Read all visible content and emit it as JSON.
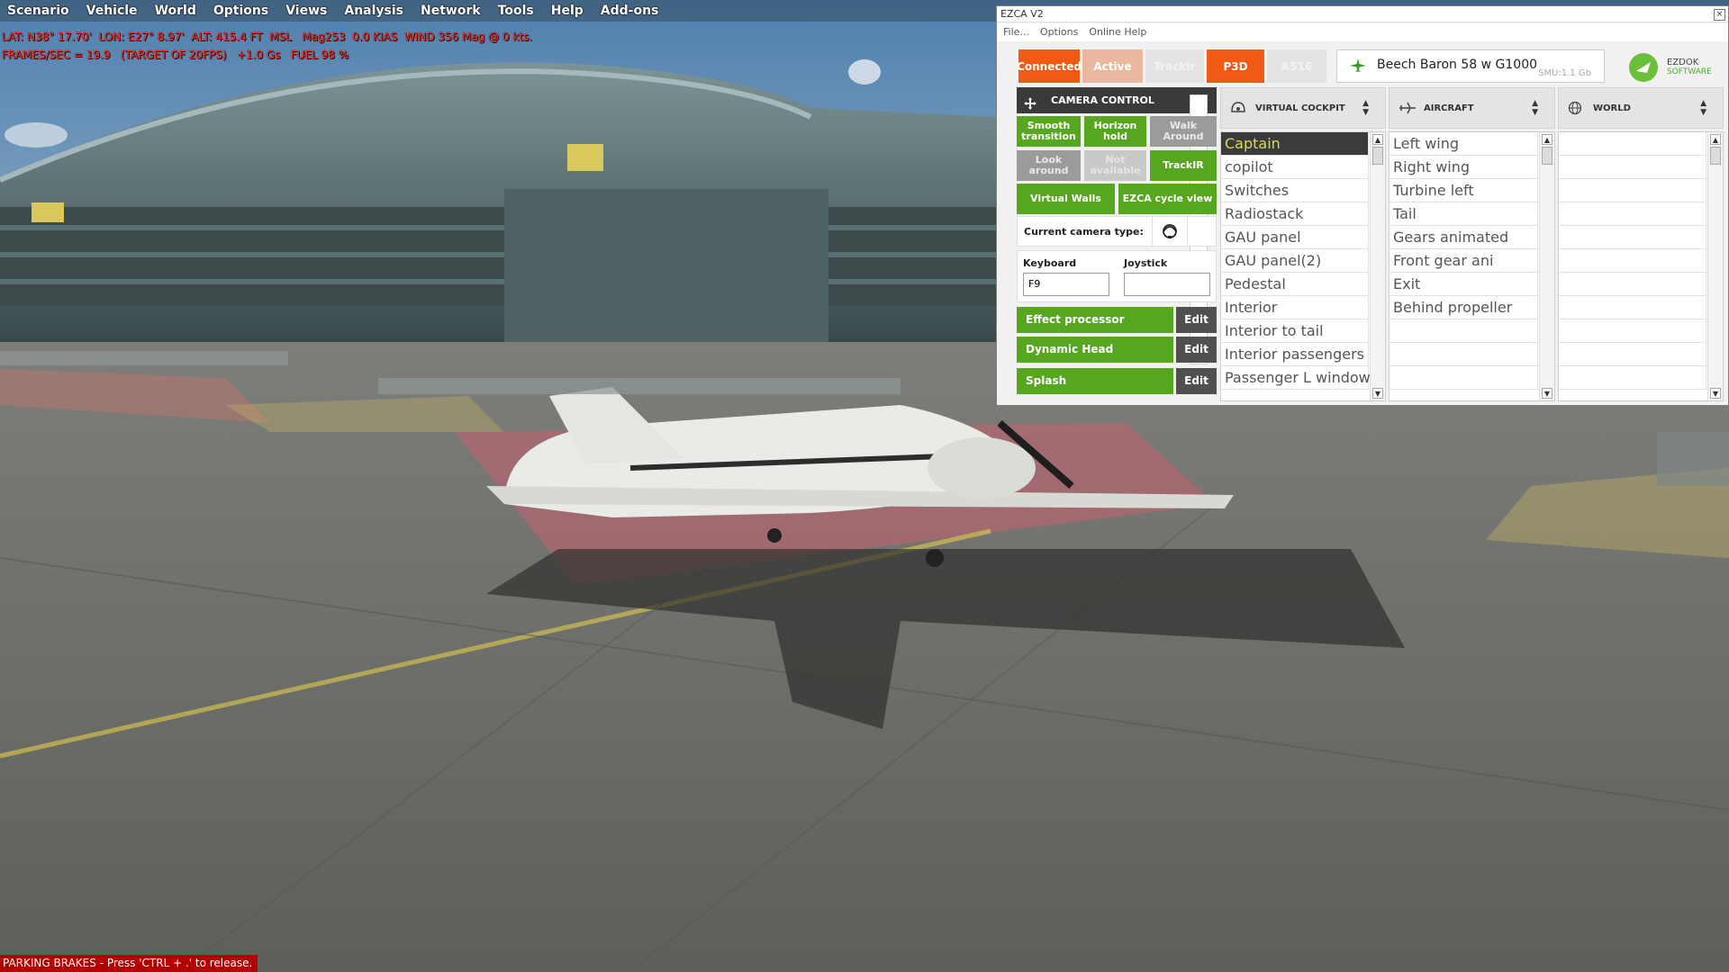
{
  "menu": {
    "items": [
      "Scenario",
      "Vehicle",
      "World",
      "Options",
      "Views",
      "Analysis",
      "Network",
      "Tools",
      "Help",
      "Add-ons"
    ]
  },
  "hud": {
    "line1": "LAT: N38° 17.70'  LON: E27° 8.97'  ALT: 415.4 FT  MSL   Mag253  0.0 KIAS  WIND 356 Mag @ 0 kts.",
    "line2": "FRAMES/SEC = 19.9   (TARGET OF 20FPS)   +1.0 Gs   FUEL 98 %"
  },
  "parking_brake": "PARKING BRAKES - Press 'CTRL + .' to release.",
  "ezca": {
    "title": "EZCA V2",
    "close": "×",
    "menu": [
      "File...",
      "Options",
      "Online Help"
    ],
    "status": {
      "connected": "Connected",
      "active": "Active",
      "trackir": "TrackIr",
      "p3d": "P3D",
      "as16": "AS16"
    },
    "aircraft": {
      "name": "Beech Baron 58 w G1000",
      "smu": "SMU:1.1 Gb"
    },
    "logo": {
      "line1": "EZDOK",
      "line2": "SOFTWARE"
    },
    "camera_control": {
      "title": "CAMERA CONTROL",
      "buttons": {
        "smooth": "Smooth transition",
        "horizon": "Horizon hold",
        "walk": "Walk Around",
        "look": "Look around",
        "disabled": "Not available",
        "trackir": "TrackIR",
        "virtual_walls": "Virtual Walls",
        "cycle": "EZCA cycle view"
      },
      "current_type_label": "Current camera type:",
      "keyboard_label": "Keyboard",
      "keyboard_value": "F9",
      "joystick_label": "Joystick",
      "joystick_value": "",
      "effects": [
        {
          "label": "Effect  processor",
          "edit": "Edit"
        },
        {
          "label": "Dynamic Head Movement",
          "edit": "Edit"
        },
        {
          "label": "Splash",
          "edit": "Edit"
        }
      ]
    },
    "virtual_cockpit": {
      "title": "VIRTUAL COCKPIT",
      "items": [
        "Captain",
        "copilot",
        "Switches",
        "Radiostack",
        "GAU panel",
        "GAU panel(2)",
        "Pedestal",
        "Interior",
        "Interior to tail",
        "Interior passengers",
        "Passenger L window"
      ]
    },
    "aircraft_views": {
      "title": "AIRCRAFT",
      "items": [
        "Left wing",
        "Right wing",
        "Turbine left",
        "Tail",
        "Gears animated",
        "Front gear ani",
        "Exit",
        "Behind propeller"
      ]
    },
    "world": {
      "title": "WORLD",
      "items": []
    }
  },
  "colors": {
    "green": "#57a620",
    "orange": "#f05a14",
    "dark": "#3a3a3a",
    "hud_red": "#ff2a1a",
    "selected_text": "#d8dc4e"
  }
}
